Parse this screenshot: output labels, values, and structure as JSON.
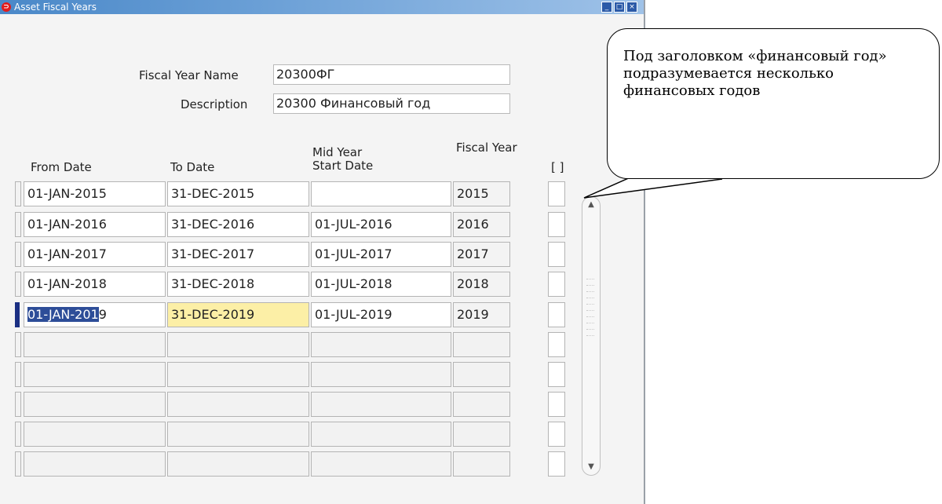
{
  "window": {
    "title": "Asset Fiscal Years",
    "controls": {
      "minimize": "_",
      "maximize": "□",
      "close": "×"
    }
  },
  "header": {
    "fiscal_year_name_label": "Fiscal Year Name",
    "fiscal_year_name_value": "20300ФГ",
    "description_label": "Description",
    "description_value": "20300 Финансовый год"
  },
  "columns": {
    "from_date": "From Date",
    "to_date": "To Date",
    "mid_year_line1": "Mid Year",
    "mid_year_line2": "Start Date",
    "fiscal_year": "Fiscal Year",
    "flag": "[ ]"
  },
  "rows": [
    {
      "from": "01-JAN-2015",
      "to": "31-DEC-2015",
      "mid": "",
      "fy": "2015"
    },
    {
      "from": "01-JAN-2016",
      "to": "31-DEC-2016",
      "mid": "01-JUL-2016",
      "fy": "2016"
    },
    {
      "from": "01-JAN-2017",
      "to": "31-DEC-2017",
      "mid": "01-JUL-2017",
      "fy": "2017"
    },
    {
      "from": "01-JAN-2018",
      "to": "31-DEC-2018",
      "mid": "01-JUL-2018",
      "fy": "2018"
    },
    {
      "from_selected": "01-JAN-201",
      "from_rest": "9",
      "to": "31-DEC-2019",
      "mid": "01-JUL-2019",
      "fy": "2019"
    }
  ],
  "callout": {
    "text": "Под заголовком «финансовый год» подразумевается несколько финансовых годов"
  },
  "colors": {
    "titlebar": "#4a88c8",
    "selection": "#2d4d98",
    "focus_field": "#fcefa6",
    "current_row_indicator": "#1b2f83"
  }
}
